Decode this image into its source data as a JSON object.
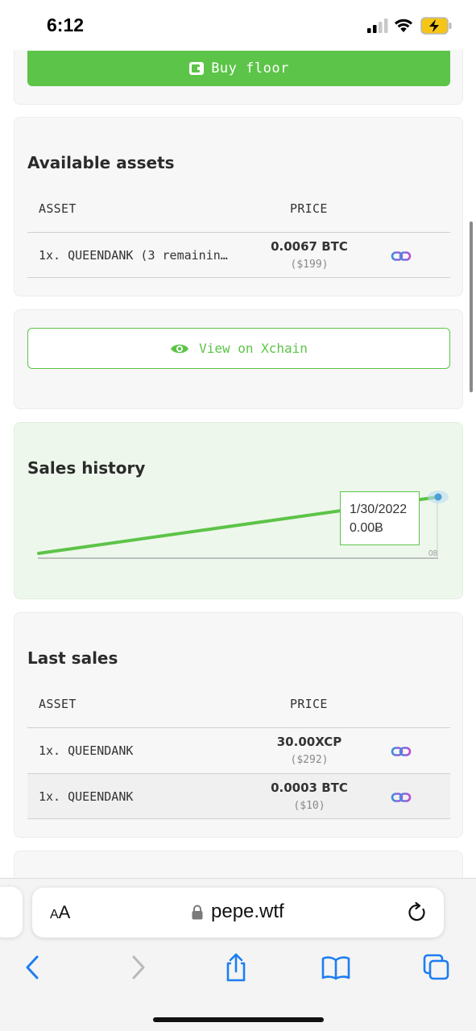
{
  "status_bar": {
    "time": "6:12"
  },
  "buy_card": {
    "button_label": "Buy floor"
  },
  "available_assets": {
    "title": "Available assets",
    "columns": [
      "ASSET",
      "PRICE"
    ],
    "rows": [
      {
        "asset": "1x. QUEENDANK (3 remainin…",
        "price": "0.0067 BTC",
        "usd": "($199)"
      }
    ]
  },
  "xchain_card": {
    "button_label": "View on Xchain"
  },
  "sales_history": {
    "title": "Sales history",
    "tooltip": {
      "date": "1/30/2022",
      "value": "0.00Ƀ"
    },
    "x_tick": "08"
  },
  "chart_data": {
    "type": "line",
    "title": "Sales history",
    "x": [
      "start",
      "1/30/2022"
    ],
    "series": [
      {
        "values": [
          0,
          1
        ]
      }
    ],
    "x_tick_labels": [
      "08"
    ],
    "tooltip": {
      "date": "1/30/2022",
      "value": "0.00Ƀ"
    },
    "colors": {
      "line": "#5cc448",
      "point": "#4a9fd8"
    }
  },
  "last_sales": {
    "title": "Last sales",
    "columns": [
      "ASSET",
      "PRICE"
    ],
    "rows": [
      {
        "asset": "1x. QUEENDANK",
        "price": "30.00XCP",
        "usd": "($292)"
      },
      {
        "asset": "1x. QUEENDANK",
        "price": "0.0003 BTC",
        "usd": "($10)"
      }
    ]
  },
  "browser": {
    "text_size_label": "AA",
    "url": "pepe.wtf",
    "nav": [
      "back-icon",
      "forward-icon",
      "share-icon",
      "bookmarks-icon",
      "tabs-icon"
    ]
  },
  "colors": {
    "accent": "#5cc448",
    "link_gradient_start": "#3b8fe0",
    "link_gradient_end": "#c04ad6"
  }
}
